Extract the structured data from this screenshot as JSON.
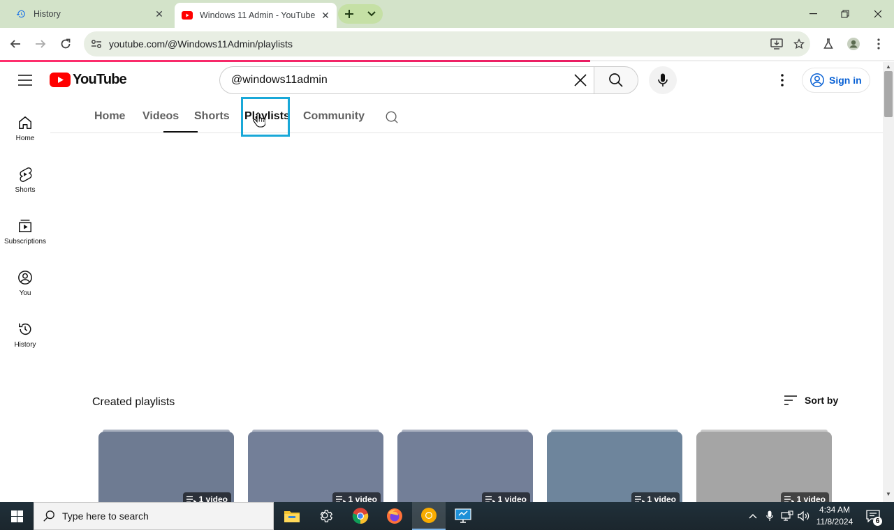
{
  "browser": {
    "tabs": [
      {
        "title": "History",
        "icon": "history-icon",
        "active": false
      },
      {
        "title": "Windows 11 Admin - YouTube",
        "icon": "youtube-favicon",
        "active": true
      }
    ],
    "url": "youtube.com/@Windows11Admin/playlists",
    "load_progress_percent": 66
  },
  "youtube": {
    "logo_text": "YouTube",
    "search_value": "@windows11admin",
    "sign_in_label": "Sign in",
    "guide": [
      {
        "label": "Home",
        "icon": "home-icon"
      },
      {
        "label": "Shorts",
        "icon": "shorts-icon"
      },
      {
        "label": "Subscriptions",
        "icon": "subscriptions-icon"
      },
      {
        "label": "You",
        "icon": "you-icon"
      },
      {
        "label": "History",
        "icon": "history-icon"
      }
    ],
    "channel_tabs": [
      {
        "label": "Home"
      },
      {
        "label": "Videos"
      },
      {
        "label": "Shorts",
        "underlined": true
      },
      {
        "label": "Playlists",
        "selected": true,
        "highlighted": true
      },
      {
        "label": "Community"
      }
    ],
    "section": {
      "title": "Created playlists",
      "sort_label": "Sort by"
    },
    "playlists": [
      {
        "badge": "1 video",
        "color": "#6e7b92"
      },
      {
        "badge": "1 video",
        "color": "#737f98"
      },
      {
        "badge": "1 video",
        "color": "#737f98"
      },
      {
        "badge": "1 video",
        "color": "#6e859c"
      },
      {
        "badge": "1 video",
        "color": "#a5a5a5"
      }
    ]
  },
  "taskbar": {
    "search_placeholder": "Type here to search",
    "time": "4:34 AM",
    "date": "11/8/2024",
    "notification_count": "6"
  },
  "colors": {
    "youtube_red": "#ff0000",
    "link_blue": "#065fd4",
    "highlight_box": "#19a8d8",
    "tabstrip_bg": "#d3e3c9"
  }
}
